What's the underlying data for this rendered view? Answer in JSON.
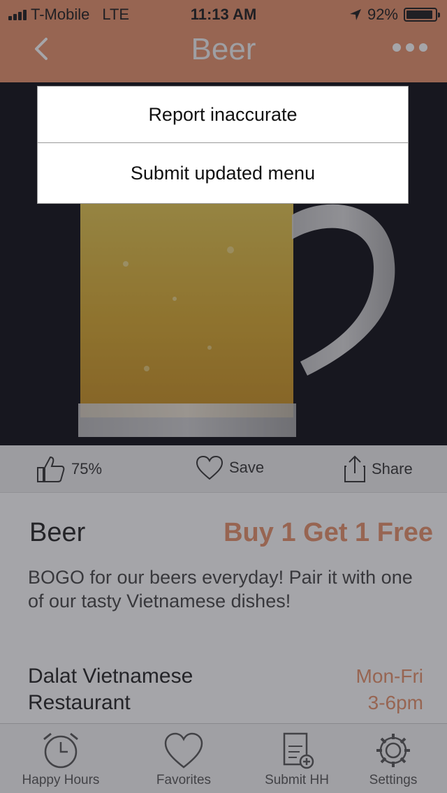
{
  "status_bar": {
    "carrier": "T-Mobile",
    "network": "LTE",
    "time": "11:13 AM",
    "battery": "92%",
    "battery_level": 0.92
  },
  "nav": {
    "title": "Beer",
    "back_icon": "chevron-left-icon",
    "more_icon": "more-dots-icon"
  },
  "actions": {
    "like_percent": "75%",
    "save_label": "Save",
    "share_label": "Share"
  },
  "deal": {
    "title": "Beer",
    "offer": "Buy 1 Get 1 Free",
    "description": "BOGO for our beers everyday! Pair it with one of our tasty Vietnamese dishes!",
    "restaurant": "Dalat Vietnamese Restaurant",
    "days": "Mon-Fri",
    "hours": "3-6pm"
  },
  "tabs": [
    {
      "label": "Happy Hours",
      "icon": "alarm-clock-icon"
    },
    {
      "label": "Favorites",
      "icon": "heart-icon"
    },
    {
      "label": "Submit HH",
      "icon": "submit-menu-icon"
    },
    {
      "label": "Settings",
      "icon": "gear-icon"
    }
  ],
  "popup_menu": {
    "items": [
      "Report inaccurate",
      "Submit updated menu"
    ]
  },
  "colors": {
    "accent": "#e7916a",
    "nav_title": "#f4f4f4"
  }
}
